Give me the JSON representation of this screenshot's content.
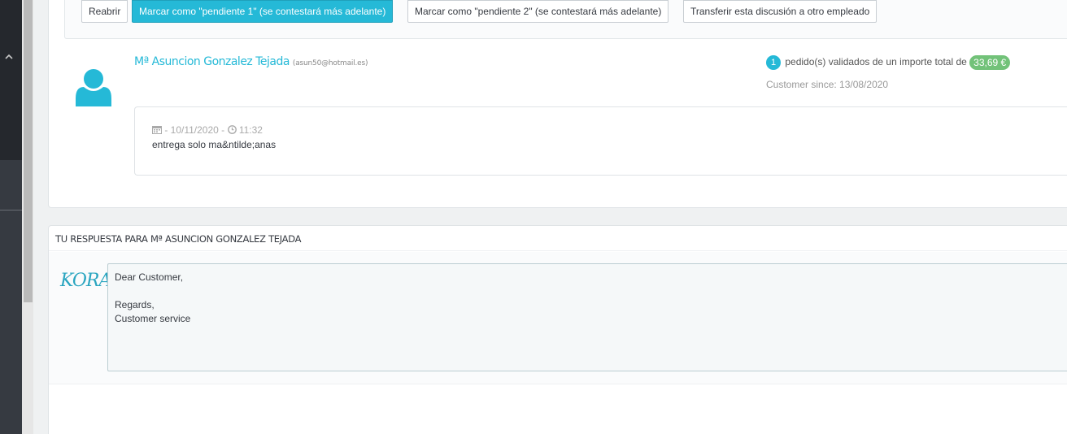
{
  "sidebar": {
    "collapse_icon": "chevron-up-icon"
  },
  "toolbar": {
    "reopen_label": "Reabrir",
    "pending1_label": "Marcar como \"pendiente 1\" (se contestará más adelante)",
    "pending2_label": "Marcar como \"pendiente 2\" (se contestará más adelante)",
    "transfer_label": "Transferir esta discusión a otro empleado"
  },
  "customer": {
    "name": "Mª Asuncion Gonzalez Tejada",
    "email": "(asun50@hotmail.es)",
    "orders_count": "1",
    "orders_text": "pedido(s) validados de un importe total de",
    "orders_amount": "33,69 €",
    "since": "Customer since: 13/08/2020"
  },
  "message": {
    "date_prefix": " - 10/11/2020 - ",
    "time": " 11:32",
    "text": "entrega solo ma&ntilde;anas"
  },
  "reply": {
    "title": "TU RESPUESTA PARA Mª ASUNCION GONZALEZ TEJADA",
    "logo_text": "KORA",
    "body": "Dear Customer,\n\nRegards,\nCustomer service"
  },
  "colors": {
    "accent": "#25b9d7",
    "success": "#72c279",
    "sidebar": "#363a41"
  }
}
